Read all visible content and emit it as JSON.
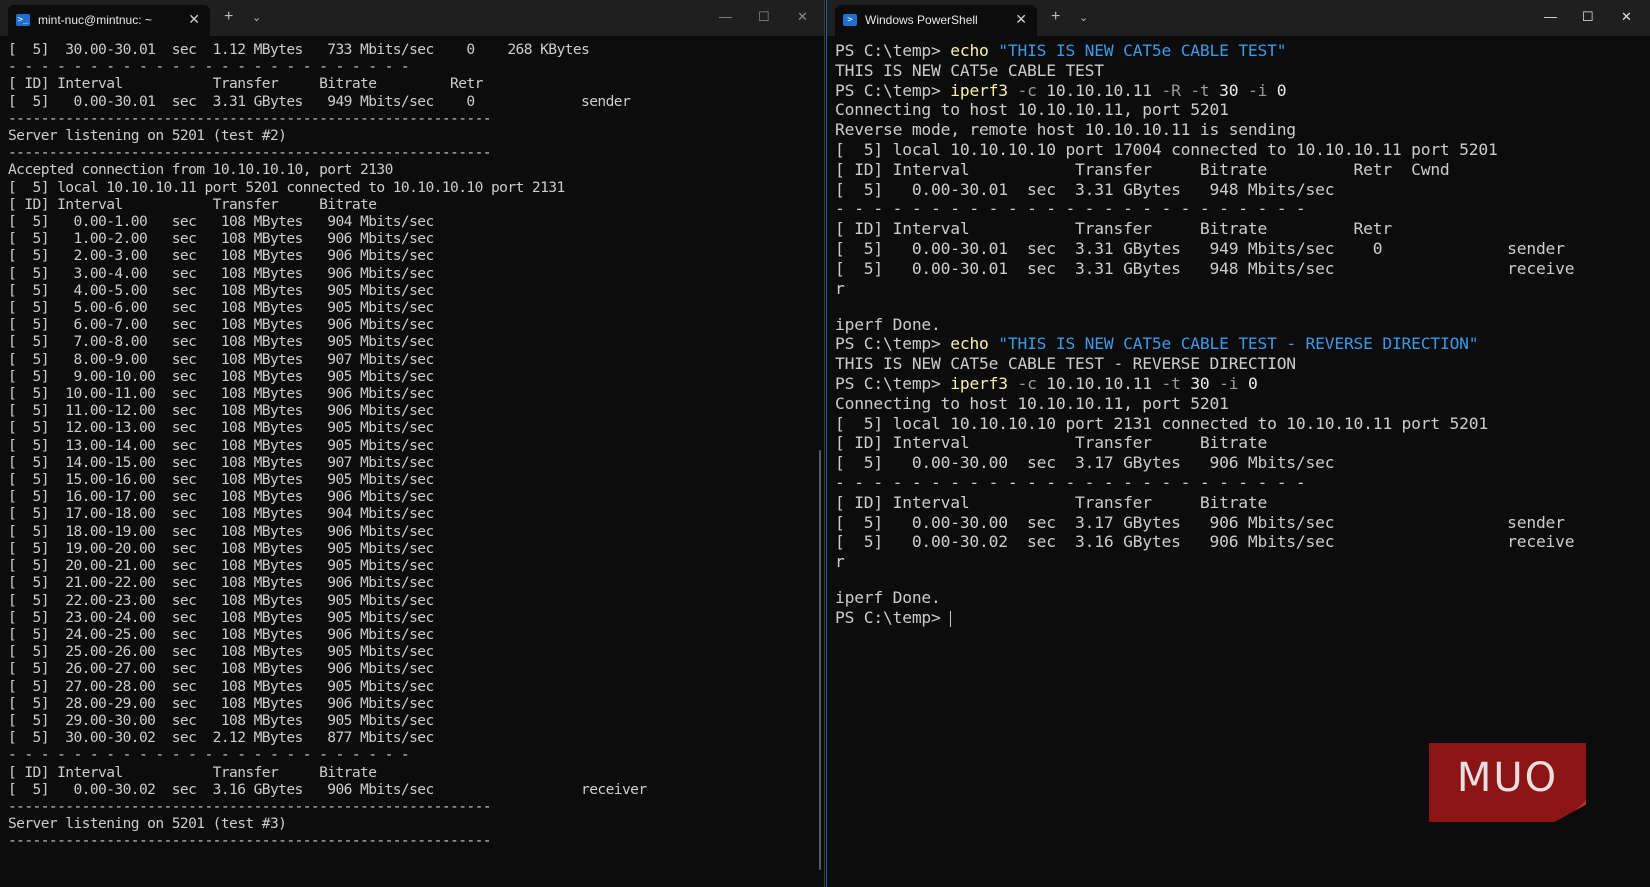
{
  "left_window": {
    "tab_title": "mint-nuc@mintnuc: ~",
    "tab_icon_glyph": ">_",
    "close_glyph": "✕",
    "new_tab_glyph": "+",
    "dropdown_glyph": "⌄",
    "minimize_glyph": "—",
    "maximize_glyph": "☐",
    "window_close_glyph": "✕",
    "lines": [
      "[  5]  30.00-30.01  sec  1.12 MBytes   733 Mbits/sec    0    268 KBytes",
      "- - - - - - - - - - - - - - - - - - - - - - - - -",
      "[ ID] Interval           Transfer     Bitrate         Retr",
      "[  5]   0.00-30.01  sec  3.31 GBytes   949 Mbits/sec    0             sender",
      "-----------------------------------------------------------",
      "Server listening on 5201 (test #2)",
      "-----------------------------------------------------------",
      "Accepted connection from 10.10.10.10, port 2130",
      "[  5] local 10.10.10.11 port 5201 connected to 10.10.10.10 port 2131",
      "[ ID] Interval           Transfer     Bitrate",
      "[  5]   0.00-1.00   sec   108 MBytes   904 Mbits/sec",
      "[  5]   1.00-2.00   sec   108 MBytes   906 Mbits/sec",
      "[  5]   2.00-3.00   sec   108 MBytes   906 Mbits/sec",
      "[  5]   3.00-4.00   sec   108 MBytes   906 Mbits/sec",
      "[  5]   4.00-5.00   sec   108 MBytes   905 Mbits/sec",
      "[  5]   5.00-6.00   sec   108 MBytes   905 Mbits/sec",
      "[  5]   6.00-7.00   sec   108 MBytes   906 Mbits/sec",
      "[  5]   7.00-8.00   sec   108 MBytes   905 Mbits/sec",
      "[  5]   8.00-9.00   sec   108 MBytes   907 Mbits/sec",
      "[  5]   9.00-10.00  sec   108 MBytes   905 Mbits/sec",
      "[  5]  10.00-11.00  sec   108 MBytes   906 Mbits/sec",
      "[  5]  11.00-12.00  sec   108 MBytes   906 Mbits/sec",
      "[  5]  12.00-13.00  sec   108 MBytes   905 Mbits/sec",
      "[  5]  13.00-14.00  sec   108 MBytes   905 Mbits/sec",
      "[  5]  14.00-15.00  sec   108 MBytes   907 Mbits/sec",
      "[  5]  15.00-16.00  sec   108 MBytes   905 Mbits/sec",
      "[  5]  16.00-17.00  sec   108 MBytes   906 Mbits/sec",
      "[  5]  17.00-18.00  sec   108 MBytes   904 Mbits/sec",
      "[  5]  18.00-19.00  sec   108 MBytes   906 Mbits/sec",
      "[  5]  19.00-20.00  sec   108 MBytes   905 Mbits/sec",
      "[  5]  20.00-21.00  sec   108 MBytes   905 Mbits/sec",
      "[  5]  21.00-22.00  sec   108 MBytes   906 Mbits/sec",
      "[  5]  22.00-23.00  sec   108 MBytes   905 Mbits/sec",
      "[  5]  23.00-24.00  sec   108 MBytes   905 Mbits/sec",
      "[  5]  24.00-25.00  sec   108 MBytes   906 Mbits/sec",
      "[  5]  25.00-26.00  sec   108 MBytes   905 Mbits/sec",
      "[  5]  26.00-27.00  sec   108 MBytes   906 Mbits/sec",
      "[  5]  27.00-28.00  sec   108 MBytes   905 Mbits/sec",
      "[  5]  28.00-29.00  sec   108 MBytes   906 Mbits/sec",
      "[  5]  29.00-30.00  sec   108 MBytes   905 Mbits/sec",
      "[  5]  30.00-30.02  sec  2.12 MBytes   877 Mbits/sec",
      "- - - - - - - - - - - - - - - - - - - - - - - - -",
      "[ ID] Interval           Transfer     Bitrate",
      "[  5]   0.00-30.02  sec  3.16 GBytes   906 Mbits/sec                  receiver",
      "-----------------------------------------------------------",
      "Server listening on 5201 (test #3)",
      "-----------------------------------------------------------"
    ]
  },
  "right_window": {
    "tab_title": "Windows PowerShell",
    "tab_icon_glyph": ">",
    "close_glyph": "✕",
    "new_tab_glyph": "+",
    "dropdown_glyph": "⌄",
    "minimize_glyph": "—",
    "maximize_glyph": "☐",
    "window_close_glyph": "✕",
    "lines": [
      [
        {
          "t": "PS C:\\temp> "
        },
        {
          "t": "echo",
          "c": "cmd"
        },
        {
          "t": " "
        },
        {
          "t": "\"THIS IS NEW CAT5e CABLE TEST\"",
          "c": "str"
        }
      ],
      [
        {
          "t": "THIS IS NEW CAT5e CABLE TEST"
        }
      ],
      [
        {
          "t": "PS C:\\temp> "
        },
        {
          "t": "iperf3",
          "c": "cmd"
        },
        {
          "t": " -c",
          "c": "op"
        },
        {
          "t": " 10.10.10.11 "
        },
        {
          "t": "-R",
          "c": "op"
        },
        {
          "t": " "
        },
        {
          "t": "-t",
          "c": "op"
        },
        {
          "t": " 30 ",
          "c": "num"
        },
        {
          "t": "-i",
          "c": "op"
        },
        {
          "t": " 0",
          "c": "num"
        }
      ],
      [
        {
          "t": "Connecting to host 10.10.10.11, port 5201"
        }
      ],
      [
        {
          "t": "Reverse mode, remote host 10.10.10.11 is sending"
        }
      ],
      [
        {
          "t": "[  5] local 10.10.10.10 port 17004 connected to 10.10.10.11 port 5201"
        }
      ],
      [
        {
          "t": "[ ID] Interval           Transfer     Bitrate         Retr  Cwnd"
        }
      ],
      [
        {
          "t": "[  5]   0.00-30.01  sec  3.31 GBytes   948 Mbits/sec"
        }
      ],
      [
        {
          "t": "- - - - - - - - - - - - - - - - - - - - - - - - -"
        }
      ],
      [
        {
          "t": "[ ID] Interval           Transfer     Bitrate         Retr"
        }
      ],
      [
        {
          "t": "[  5]   0.00-30.01  sec  3.31 GBytes   949 Mbits/sec    0             sender"
        }
      ],
      [
        {
          "t": "[  5]   0.00-30.01  sec  3.31 GBytes   948 Mbits/sec                  receive"
        }
      ],
      [
        {
          "t": "r"
        }
      ],
      [
        {
          "t": ""
        }
      ],
      [
        {
          "t": "iperf Done."
        }
      ],
      [
        {
          "t": "PS C:\\temp> "
        },
        {
          "t": "echo",
          "c": "cmd"
        },
        {
          "t": " "
        },
        {
          "t": "\"THIS IS NEW CAT5e CABLE TEST - REVERSE DIRECTION\"",
          "c": "str"
        }
      ],
      [
        {
          "t": "THIS IS NEW CAT5e CABLE TEST - REVERSE DIRECTION"
        }
      ],
      [
        {
          "t": "PS C:\\temp> "
        },
        {
          "t": "iperf3",
          "c": "cmd"
        },
        {
          "t": " -c",
          "c": "op"
        },
        {
          "t": " 10.10.10.11 "
        },
        {
          "t": "-t",
          "c": "op"
        },
        {
          "t": " 30 ",
          "c": "num"
        },
        {
          "t": "-i",
          "c": "op"
        },
        {
          "t": " 0",
          "c": "num"
        }
      ],
      [
        {
          "t": "Connecting to host 10.10.10.11, port 5201"
        }
      ],
      [
        {
          "t": "[  5] local 10.10.10.10 port 2131 connected to 10.10.10.11 port 5201"
        }
      ],
      [
        {
          "t": "[ ID] Interval           Transfer     Bitrate"
        }
      ],
      [
        {
          "t": "[  5]   0.00-30.00  sec  3.17 GBytes   906 Mbits/sec"
        }
      ],
      [
        {
          "t": "- - - - - - - - - - - - - - - - - - - - - - - - -"
        }
      ],
      [
        {
          "t": "[ ID] Interval           Transfer     Bitrate"
        }
      ],
      [
        {
          "t": "[  5]   0.00-30.00  sec  3.17 GBytes   906 Mbits/sec                  sender"
        }
      ],
      [
        {
          "t": "[  5]   0.00-30.02  sec  3.16 GBytes   906 Mbits/sec                  receive"
        }
      ],
      [
        {
          "t": "r"
        }
      ],
      [
        {
          "t": ""
        }
      ],
      [
        {
          "t": "iperf Done."
        }
      ],
      [
        {
          "t": "PS C:\\temp> "
        }
      ]
    ]
  },
  "watermark": {
    "text": "MUO",
    "color": "#8c1414"
  }
}
